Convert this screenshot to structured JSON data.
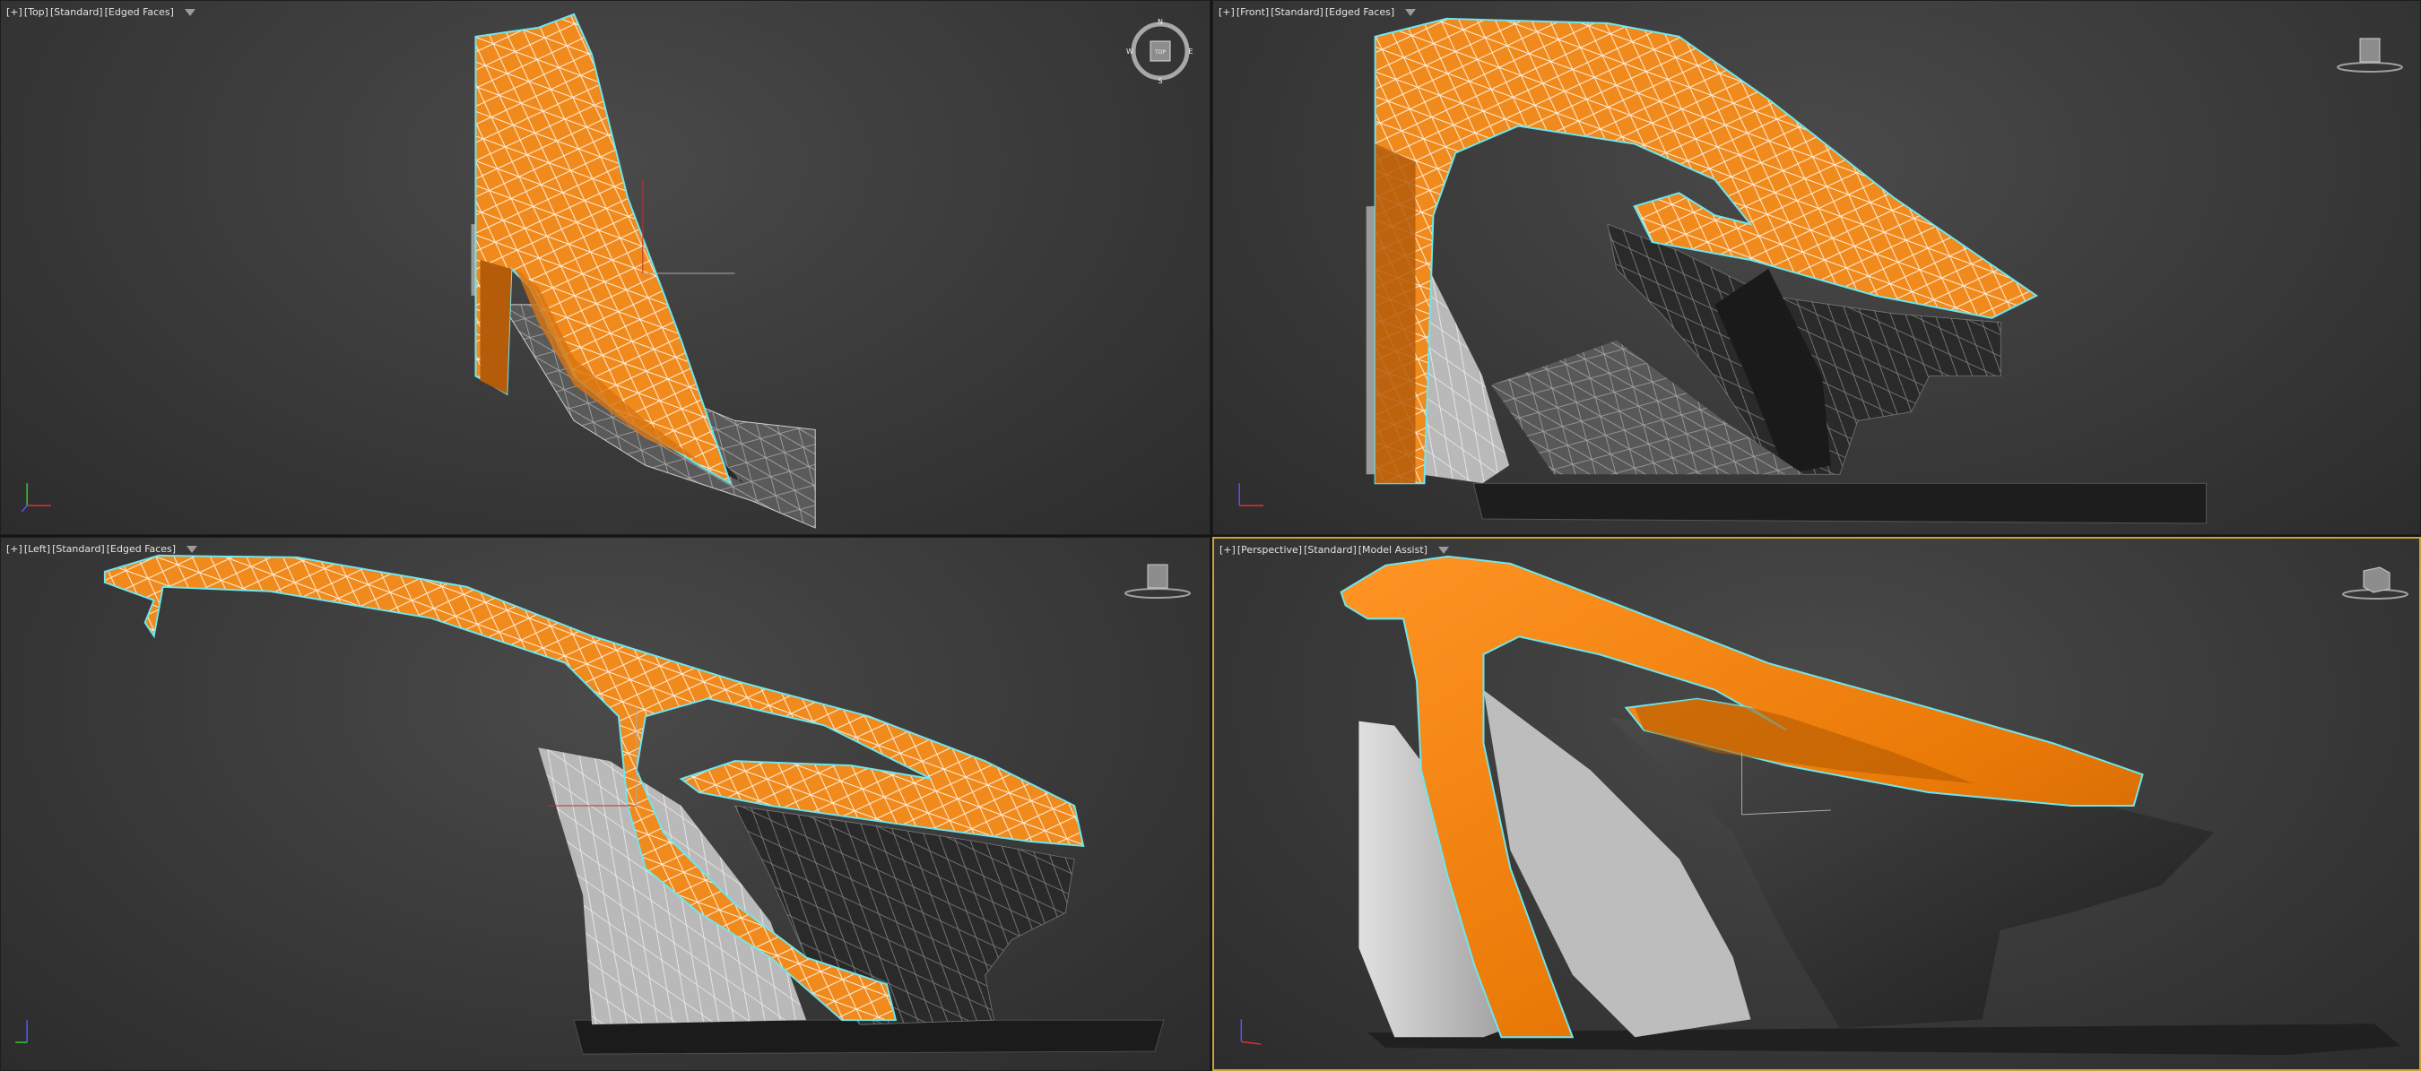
{
  "viewports": {
    "top": {
      "plus": "[+]",
      "view": "[Top]",
      "shading": "[Standard]",
      "mode": "[Edged Faces]"
    },
    "front": {
      "plus": "[+]",
      "view": "[Front]",
      "shading": "[Standard]",
      "mode": "[Edged Faces]"
    },
    "left": {
      "plus": "[+]",
      "view": "[Left]",
      "shading": "[Standard]",
      "mode": "[Edged Faces]"
    },
    "persp": {
      "plus": "[+]",
      "view": "[Perspective]",
      "shading": "[Standard]",
      "mode": "[Model Assist]"
    }
  },
  "compass": {
    "n": "N",
    "s": "S",
    "e": "E",
    "w": "W",
    "face": "TOP"
  },
  "colors": {
    "selection_orange": "#f2840d",
    "selection_outline": "#6fe6ee",
    "active_border": "#c9a23a",
    "wire_gray": "#8c8c8c",
    "dark_body": "#262626"
  },
  "icons": [
    "filter-icon",
    "view-compass-icon",
    "viewcube-icon",
    "axis-tripod-icon"
  ]
}
